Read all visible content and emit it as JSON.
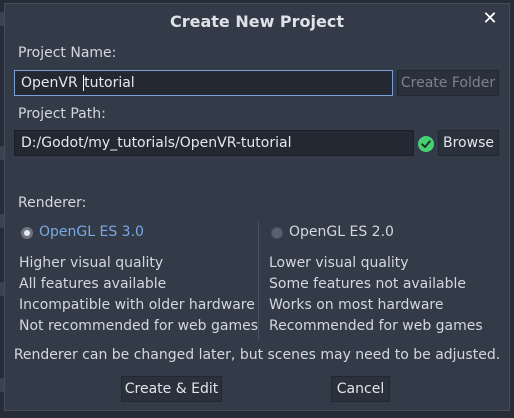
{
  "dialog": {
    "title": "Create New Project",
    "close_glyph": "✕"
  },
  "project_name": {
    "label": "Project Name:",
    "value": "OpenVR tutorial",
    "create_folder_label": "Create Folder"
  },
  "project_path": {
    "label": "Project Path:",
    "value": "D:/Godot/my_tutorials/OpenVR-tutorial",
    "status_icon": "check-circle-icon",
    "browse_label": "Browse"
  },
  "renderer": {
    "label": "Renderer:",
    "options": [
      {
        "label": "OpenGL ES 3.0",
        "selected": true,
        "features": [
          "Higher visual quality",
          "All features available",
          "Incompatible with older hardware",
          "Not recommended for web games"
        ]
      },
      {
        "label": "OpenGL ES 2.0",
        "selected": false,
        "features": [
          "Lower visual quality",
          "Some features not available",
          "Works on most hardware",
          "Recommended for web games"
        ]
      }
    ],
    "note": "Renderer can be changed later, but scenes may need to be adjusted."
  },
  "actions": {
    "confirm_label": "Create & Edit",
    "cancel_label": "Cancel"
  },
  "colors": {
    "accent": "#7aa7e6",
    "valid": "#45d173",
    "dialog_bg": "#343b48"
  }
}
